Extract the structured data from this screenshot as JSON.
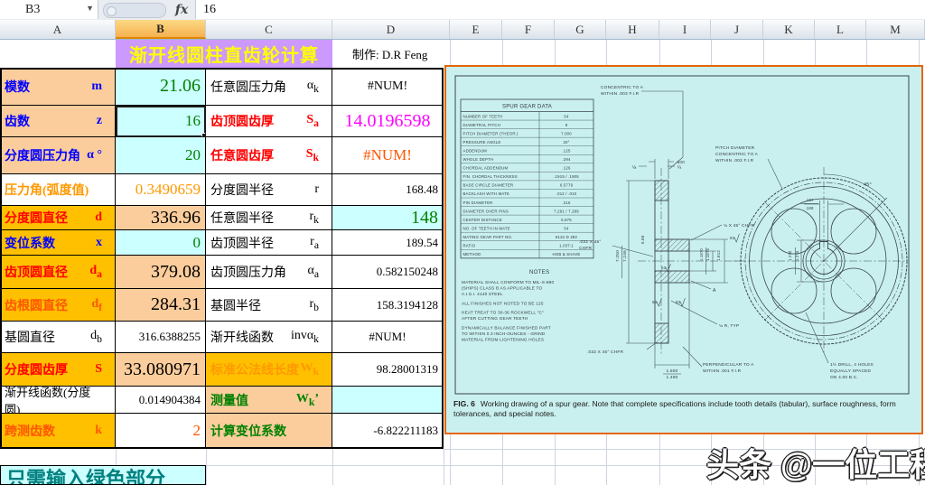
{
  "formula_bar": {
    "name_box": "B3",
    "fx_label": "fx",
    "formula_value": "16"
  },
  "column_headers": [
    "A",
    "B",
    "C",
    "D",
    "E",
    "F",
    "G",
    "H",
    "I",
    "J",
    "K",
    "L",
    "M"
  ],
  "selected_column": "B",
  "title": {
    "text": "渐开线圆柱直齿轮计算",
    "maker": "制作: D.R Feng"
  },
  "colors": {
    "input_cell": "#CCFFFF",
    "label_peach": "#FBCD9C",
    "label_yellow": "#FFC000",
    "title_bg": "#CC99FF",
    "title_text": "#FFFF00",
    "image_bg": "#C9F0EE",
    "image_border": "#E5660B"
  },
  "table": {
    "rows": [
      {
        "a_label": "模数",
        "a_sym": "m",
        "a_style": "bg-peach c-blue bold",
        "b_value": "21.06",
        "b_style": "bg-cyan c-green sz-big",
        "c_label": "任意圆压力角",
        "c_sym": "α",
        "c_sub": "k",
        "c_style": "",
        "d_value": "#NUM!",
        "d_style": "center"
      },
      {
        "a_label": "齿数",
        "a_sym": "z",
        "a_style": "bg-peach c-blue bold",
        "selected": true,
        "b_value": "16",
        "b_style": "bg-cyan c-green sz-med",
        "c_label": "齿顶圆齿厚",
        "c_sym": "S",
        "c_sub": "a",
        "c_style": "c-red bold",
        "d_value": "14.0196598",
        "d_style": "c-magenta sz-big center"
      },
      {
        "a_label": "分度圆压力角",
        "a_sym": "α °",
        "a_style": "bg-peach c-blue bold",
        "b_value": "20",
        "b_style": "bg-cyan c-green sz-med",
        "c_label": "任意圆齿厚",
        "c_sym": "S",
        "c_sub": "k",
        "c_style": "c-red bold",
        "d_value": "#NUM!",
        "d_style": "c-orangered sz-med center"
      },
      {
        "a_label": "压力角(弧度值)",
        "a_sym": "",
        "a_style": "c-orange bold",
        "b_value": "0.3490659",
        "b_style": "c-orange sz-med",
        "c_label": "分度圆半径",
        "c_sym": "r",
        "c_sub": "",
        "c_style": "",
        "d_value": "168.48",
        "d_style": "sz-small"
      },
      {
        "a_label": "分度圆直径",
        "a_sym": "d",
        "a_style": "bg-yellow c-red bold",
        "b_value": "336.96",
        "b_style": "bg-peach sz-big",
        "c_label": "任意圆半径",
        "c_sym": "r",
        "c_sub": "k",
        "c_style": "",
        "d_value": "148",
        "d_style": "bg-cyan c-green sz-big"
      },
      {
        "a_label": "变位系数",
        "a_sym": "x",
        "a_style": "bg-yellow c-blue bold",
        "b_value": "0",
        "b_style": "bg-cyan c-green sz-med",
        "c_label": "齿顶圆半径",
        "c_sym": "r",
        "c_sub": "a",
        "c_style": "",
        "d_value": "189.54",
        "d_style": "sz-small"
      },
      {
        "a_label": "齿顶圆直径",
        "a_sym": "d",
        "a_sub": "a",
        "a_style": "bg-yellow c-red bold",
        "b_value": "379.08",
        "b_style": "bg-peach sz-big",
        "c_label": "齿顶圆压力角",
        "c_sym": "α",
        "c_sub": "a",
        "c_style": "",
        "d_value": "0.582150248",
        "d_style": "sz-small"
      },
      {
        "a_label": "齿根圆直径",
        "a_sym": "d",
        "a_sub": "f",
        "a_style": "bg-yellow c-orangered bold",
        "b_value": "284.31",
        "b_style": "bg-peach sz-big",
        "c_label": "基圆半径",
        "c_sym": "r",
        "c_sub": "b",
        "c_style": "",
        "d_value": "158.3194128",
        "d_style": "sz-small"
      },
      {
        "a_label": "基圆直径",
        "a_sym": "d",
        "a_sub": "b",
        "a_style": "",
        "b_value": "316.6388255",
        "b_style": "sz-small",
        "c_label": "渐开线函数",
        "c_sym": "invα",
        "c_sub": "k",
        "c_style": "",
        "d_value": "#NUM!",
        "d_style": "sz-small center"
      },
      {
        "a_label": "分度圆齿厚",
        "a_sym": "S",
        "a_style": "bg-yellow c-red bold",
        "b_value": "33.080971",
        "b_style": "bg-peach sz-big",
        "c_label": "标准公法线长度",
        "c_sym": "W",
        "c_sub": "k",
        "c_style": "bg-yellow c-orange bold",
        "d_value": "98.28001319",
        "d_style": "sz-small"
      },
      {
        "a_label": "渐开线函数(分度圆)",
        "a_sym": "",
        "a_style": "sz-small",
        "b_value": "0.014904384",
        "b_style": "sz-small",
        "c_label": "测量值",
        "c_sym": "W",
        "c_sub": "k",
        "c_tail": "’",
        "c_style": "bg-peach c-green bold",
        "d_value": "",
        "d_style": "bg-cyan"
      },
      {
        "a_label": "跨测齿数",
        "a_sym": "k",
        "a_style": "bg-yellow c-orangered bold",
        "b_value": "2",
        "b_style": "c-orangered sz-med",
        "c_label": "计算变位系数",
        "c_sym": "",
        "c_style": "bg-peach c-green bold",
        "d_value": "-6.822211183",
        "d_style": "sz-small"
      }
    ]
  },
  "note_bottom": "只需输入绿色部分",
  "watermark": "头条 @一位工程师",
  "gear_drawing": {
    "data_table": {
      "title": "SPUR GEAR DATA",
      "rows": [
        [
          "NUMBER OF TEETH",
          "54"
        ],
        [
          "DIAMETRAL PITCH",
          "8"
        ],
        [
          "PITCH DIAMETER (THEOR.)",
          "7.000"
        ],
        [
          "PRESSURE ANGLE",
          "20°"
        ],
        [
          "ADDENDUM",
          ".125"
        ],
        [
          "WHOLE DEPTH",
          ".294"
        ],
        [
          "CHORDAL ADDENDUM",
          ".126"
        ],
        [
          "FIN. CHORDAL THICKNESS",
          ".1915 / .1905"
        ],
        [
          "BASE CIRCLE DIAMETER",
          "6.5779"
        ],
        [
          "BACKLASH WITH MATE",
          ".012 / .010"
        ],
        [
          "PIN DIAMETER",
          ".216"
        ],
        [
          "DIAMETER OVER PINS",
          "7.291 / 7.289"
        ],
        [
          "CENTER DISTANCE",
          "6.875"
        ],
        [
          "NO. OF TEETH IN MATE",
          "54"
        ],
        [
          "MATING GEAR PART NO.",
          "6134 D 282"
        ],
        [
          "RATIO",
          "1.037:1"
        ],
        [
          "METHOD",
          "HOB & SHAVE"
        ]
      ]
    },
    "notes_title": "NOTES",
    "notes": [
      [
        "MATERIAL SHALL CONFORM TO MIL-S-890",
        "(SHIPS) CLASS B AS APPLICABLE TO",
        "A.I.S.I. 4140 STEEL"
      ],
      [
        "ALL FINISHES NOT NOTED TO BE 125"
      ],
      [
        "HEAT TREAT TO 30-36 ROCKWELL \"C\"",
        "AFTER CUTTING GEAR TEETH"
      ],
      [
        "DYNAMICALLY BALANCE FINISHED PART",
        "TO WITHIN 0.3 INCH-OUNCES - GRIND",
        "MATERIAL FROM LIGHTENING HOLES"
      ]
    ],
    "annotations": {
      "concentric": [
        "CONCENTRIC TO A",
        "WITHIN .003 F.I.R"
      ],
      "pitch_dia": [
        "PITCH DIAMETER",
        "CONCENTRIC TO A",
        "WITHIN .002 F.I.R"
      ],
      "dim_500": ".500",
      "frac_18": "⅛",
      "frac_14": "¼",
      "chfr_032_a": [
        ".032 X 45°",
        "CHFR"
      ],
      "chfr_032_b": ".032 X 45° CHFR",
      "chfr_18": "⅛ X 45° CHFR",
      "dim_7250": "7.250",
      "dim_7246": "7.246",
      "dim_688": "6.88",
      "dim_11870": "1.1870",
      "dim_11875": "1.1875",
      "dim_1812": "1.812",
      "datum_a": "A",
      "r_typ": "⅛ R, TYP",
      "dim_1500": "1.500",
      "dim_1490": "1.490",
      "perp": [
        "PERPENDICULAR TO A",
        "WITHIN  .001 F.I.R"
      ],
      "drill": [
        "1½ DRILL, 4 HOLES",
        "EQUALLY SPACED",
        "ON 4.00 B.C."
      ],
      "deg45": "45°",
      "dim_187": ".187",
      "dim_188": ".188",
      "dim_1270": "1.270",
      "dim_1275": "1.275",
      "f63_a": "63",
      "f63_b": "63",
      "f63_c": "63",
      "f63_d": "63"
    },
    "caption_label": "FIG. 6",
    "caption": "Working drawing of a spur gear. Note that complete specifications include tooth details (tabular), surface roughness, form tolerances, and special notes."
  }
}
